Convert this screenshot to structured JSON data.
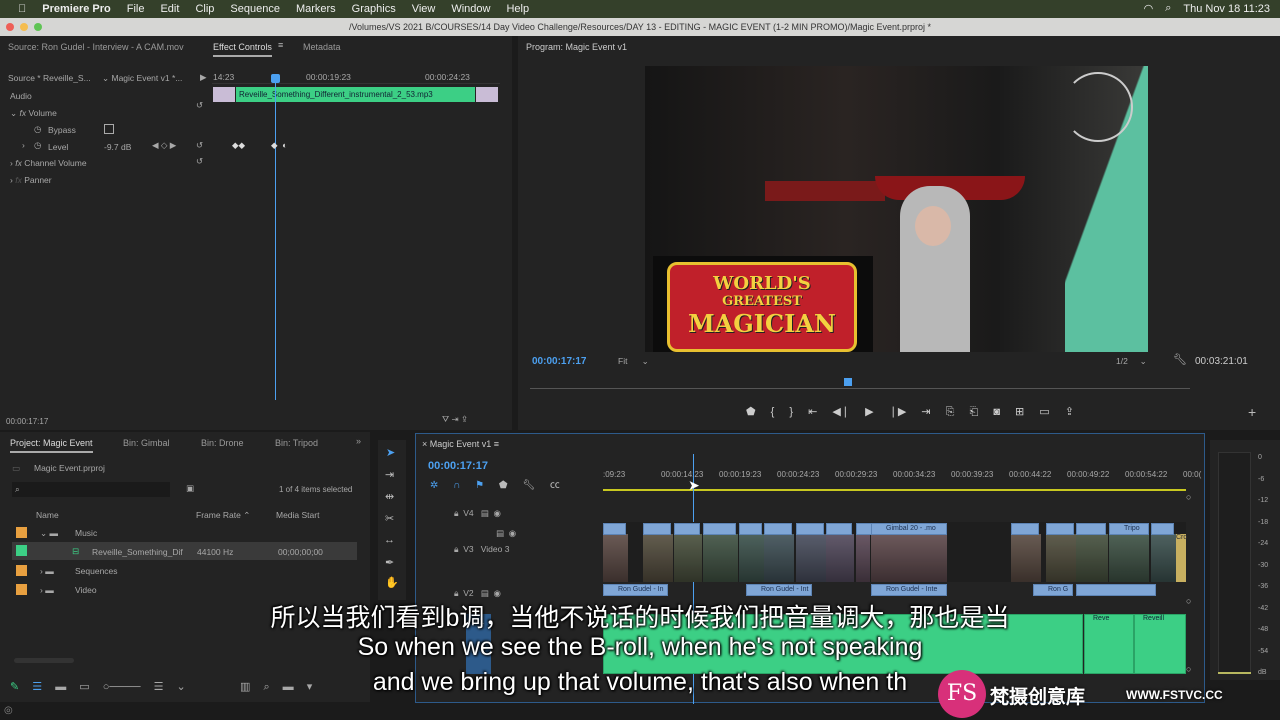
{
  "menubar": {
    "app": "Premiere Pro",
    "items": [
      "File",
      "Edit",
      "Clip",
      "Sequence",
      "Markers",
      "Graphics",
      "View",
      "Window",
      "Help"
    ],
    "datetime": "Thu Nov 18  11:23"
  },
  "window_title": "/Volumes/VS 2021 B/COURSES/14 Day Video Challenge/Resources/DAY 13 - EDITING - MAGIC EVENT (1-2 MIN PROMO)/Magic Event.prproj *",
  "source_panel": {
    "tabs": [
      "Source: Ron Gudel - Interview - A CAM.mov",
      "Effect Controls",
      "Metadata"
    ],
    "source_select": "Source * Reveille_S...",
    "sequence_select": "Magic Event v1 *...",
    "ruler": [
      "14:23",
      "00:00:19:23",
      "00:00:24:23"
    ],
    "clip_name": "Reveille_Something_Different_instrumental_2_53.mp3",
    "section": "Audio",
    "effects": [
      {
        "name": "Volume"
      },
      {
        "name": "Bypass"
      },
      {
        "name": "Level",
        "value": "-9.7 dB"
      },
      {
        "name": "Channel Volume"
      },
      {
        "name": "Panner"
      }
    ],
    "timecode": "00:00:17:17"
  },
  "program": {
    "title": "Program: Magic Event v1",
    "timecode": "00:00:17:17",
    "fit": "Fit",
    "resolution": "1/2",
    "duration": "00:03:21:01",
    "sign_text": [
      "WORLD'S",
      "GREATEST",
      "MAGICIAN"
    ]
  },
  "project": {
    "tabs": [
      "Project: Magic Event",
      "Bin: Gimbal",
      "Bin: Drone",
      "Bin: Tripod"
    ],
    "file": "Magic Event.prproj",
    "selection": "1 of 4 items selected",
    "columns": [
      "Name",
      "Frame Rate",
      "Media Start"
    ],
    "items": [
      {
        "name": "Music",
        "color": "#e8a040"
      },
      {
        "name": "Reveille_Something_Dif",
        "rate": "44100 Hz",
        "start": "00;00;00;00",
        "color": "#3ccf85"
      },
      {
        "name": "Sequences",
        "color": "#e8a040"
      },
      {
        "name": "Video",
        "color": "#e8a040"
      }
    ]
  },
  "timeline": {
    "title": "Magic Event v1",
    "timecode": "00:00:17:17",
    "ruler": [
      ":09:23",
      "00:00:14:23",
      "00:00:19:23",
      "00:00:24:23",
      "00:00:29:23",
      "00:00:34:23",
      "00:00:39:23",
      "00:00:44:22",
      "00:00:49:22",
      "00:00:54:22",
      "00:0("
    ],
    "tracks": [
      "V4",
      "V3",
      "V2",
      "A1"
    ],
    "track_name": "Video 3",
    "v3_clips": [
      "Gimbal 20 - .mo",
      "Tripo",
      "Cro"
    ],
    "v2_clips": [
      "Ron Gudel - In",
      "Ron Gudel - Int",
      "Ron Gudel - Inte",
      "Ron G"
    ],
    "a_clips": [
      "Reve",
      "Reveill"
    ]
  },
  "meter": {
    "labels": [
      "0",
      "-6",
      "-12",
      "-18",
      "-24",
      "-30",
      "-36",
      "-42",
      "-48",
      "-54",
      "dB"
    ]
  },
  "subtitles": [
    "所以当我们看到b调，当他不说话的时候我们把音量调大，那也是当",
    "So when we see the B-roll, when he's not speaking",
    "and we bring up that volume, that's also when th"
  ],
  "watermark": {
    "logo": "FS",
    "name": "梵摄创意库",
    "url": "WWW.FSTVC.CC"
  },
  "colors": {
    "accent": "#4ca0f0",
    "audio_clip": "#3ccf85",
    "video_clip": "#7fa6d6",
    "label_orange": "#e8a040"
  }
}
